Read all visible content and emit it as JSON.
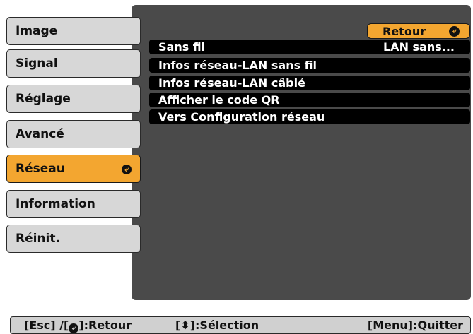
{
  "sidebar": {
    "items": [
      {
        "label": "Image"
      },
      {
        "label": "Signal"
      },
      {
        "label": "Réglage"
      },
      {
        "label": "Avancé"
      },
      {
        "label": "Réseau"
      },
      {
        "label": "Information"
      },
      {
        "label": "Réinit."
      }
    ],
    "active_index": 4
  },
  "menu": {
    "back_label": "Retour",
    "rows": [
      {
        "label": "Sans fil",
        "value": "LAN sans..."
      },
      {
        "label": "Infos réseau-LAN sans fil"
      },
      {
        "label": "Infos réseau-LAN câblé"
      },
      {
        "label": "Afficher le code QR"
      },
      {
        "label": "Vers Configuration réseau"
      }
    ]
  },
  "footer": {
    "esc_prefix": "[Esc] /[",
    "esc_suffix": "]:Retour",
    "select_prefix": "[",
    "select_suffix": "]:Sélection",
    "quit_hint": "[Menu]:Quitter"
  },
  "icons": {
    "enter": "enter-icon",
    "up_down": "up-down-arrow-icon"
  },
  "colors": {
    "accent": "#f3a630",
    "panel": "#4a4a4a",
    "sidebar_item": "#d7d7d7",
    "row": "#000000",
    "footer": "#d0d0d0"
  }
}
